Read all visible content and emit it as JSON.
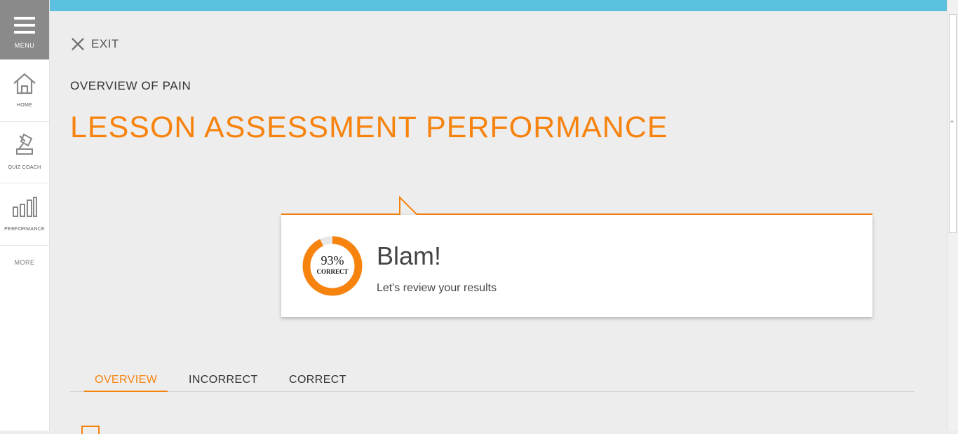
{
  "sidebar": {
    "menu_label": "MENU",
    "items": [
      {
        "label": "HOME",
        "icon": "home-icon"
      },
      {
        "label": "QUIZ COACH",
        "icon": "quiz-coach-icon"
      },
      {
        "label": "PERFORMANCE",
        "icon": "bar-chart-icon"
      }
    ],
    "more_label": "MORE"
  },
  "header": {
    "exit_label": "EXIT",
    "lesson_name": "OVERVIEW OF PAIN",
    "page_title": "LESSON ASSESSMENT PERFORMANCE"
  },
  "result": {
    "percent_text": "93%",
    "percent_value": 93,
    "percent_label": "CORRECT",
    "headline": "Blam!",
    "message": "Let's review your results"
  },
  "tabs": [
    {
      "label": "OVERVIEW",
      "active": true
    },
    {
      "label": "INCORRECT",
      "active": false
    },
    {
      "label": "CORRECT",
      "active": false
    }
  ],
  "colors": {
    "accent": "#f7830f",
    "top_bar": "#5bc0de",
    "menu_bg": "#8a8a8a",
    "background": "#ededed"
  }
}
